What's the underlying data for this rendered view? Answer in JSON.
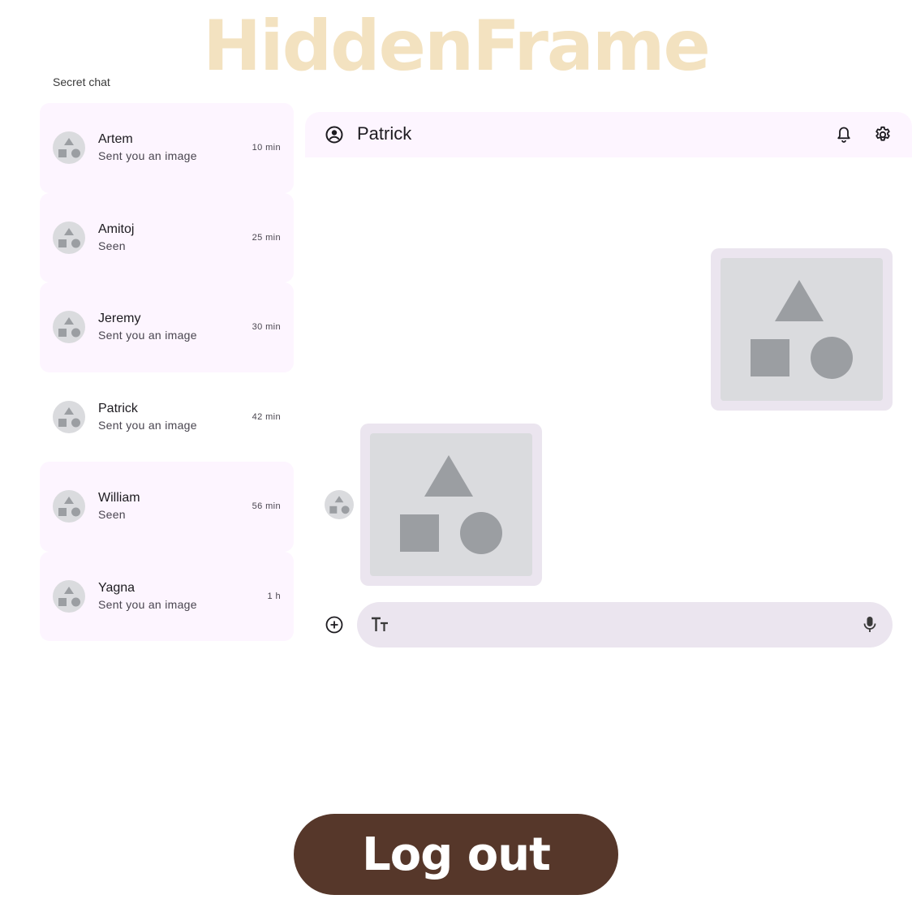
{
  "app": {
    "brand": "HiddenFrame"
  },
  "sidebar": {
    "title": "Secret chat",
    "items": [
      {
        "name": "Artem",
        "preview": "Sent you an image",
        "time": "10 min",
        "selected": false
      },
      {
        "name": "Amitoj",
        "preview": "Seen",
        "time": "25 min",
        "selected": false
      },
      {
        "name": "Jeremy",
        "preview": "Sent you an image",
        "time": "30 min",
        "selected": false
      },
      {
        "name": "Patrick",
        "preview": "Sent you an image",
        "time": "42 min",
        "selected": true
      },
      {
        "name": "William",
        "preview": "Seen",
        "time": "56 min",
        "selected": false
      },
      {
        "name": "Yagna",
        "preview": "Sent you an image",
        "time": "1 h",
        "selected": false
      }
    ]
  },
  "conversation": {
    "title": "Patrick",
    "header_icons": [
      "account-circle-icon",
      "bell-icon",
      "gear-icon"
    ],
    "messages": [
      {
        "from": "me",
        "type": "image"
      },
      {
        "from": "Patrick",
        "type": "image"
      }
    ]
  },
  "composer": {
    "placeholder": "",
    "icons": [
      "add-circle-icon",
      "text-format-icon",
      "mic-icon"
    ]
  },
  "footer": {
    "logout_label": "Log out"
  },
  "colors": {
    "brand": "#f3e2c0",
    "surface": "#fdf5ff",
    "bubble": "#ebe5ef",
    "placeholder": "#dadbde",
    "shape": "#9b9ea2",
    "logout_bg": "#56372a"
  }
}
